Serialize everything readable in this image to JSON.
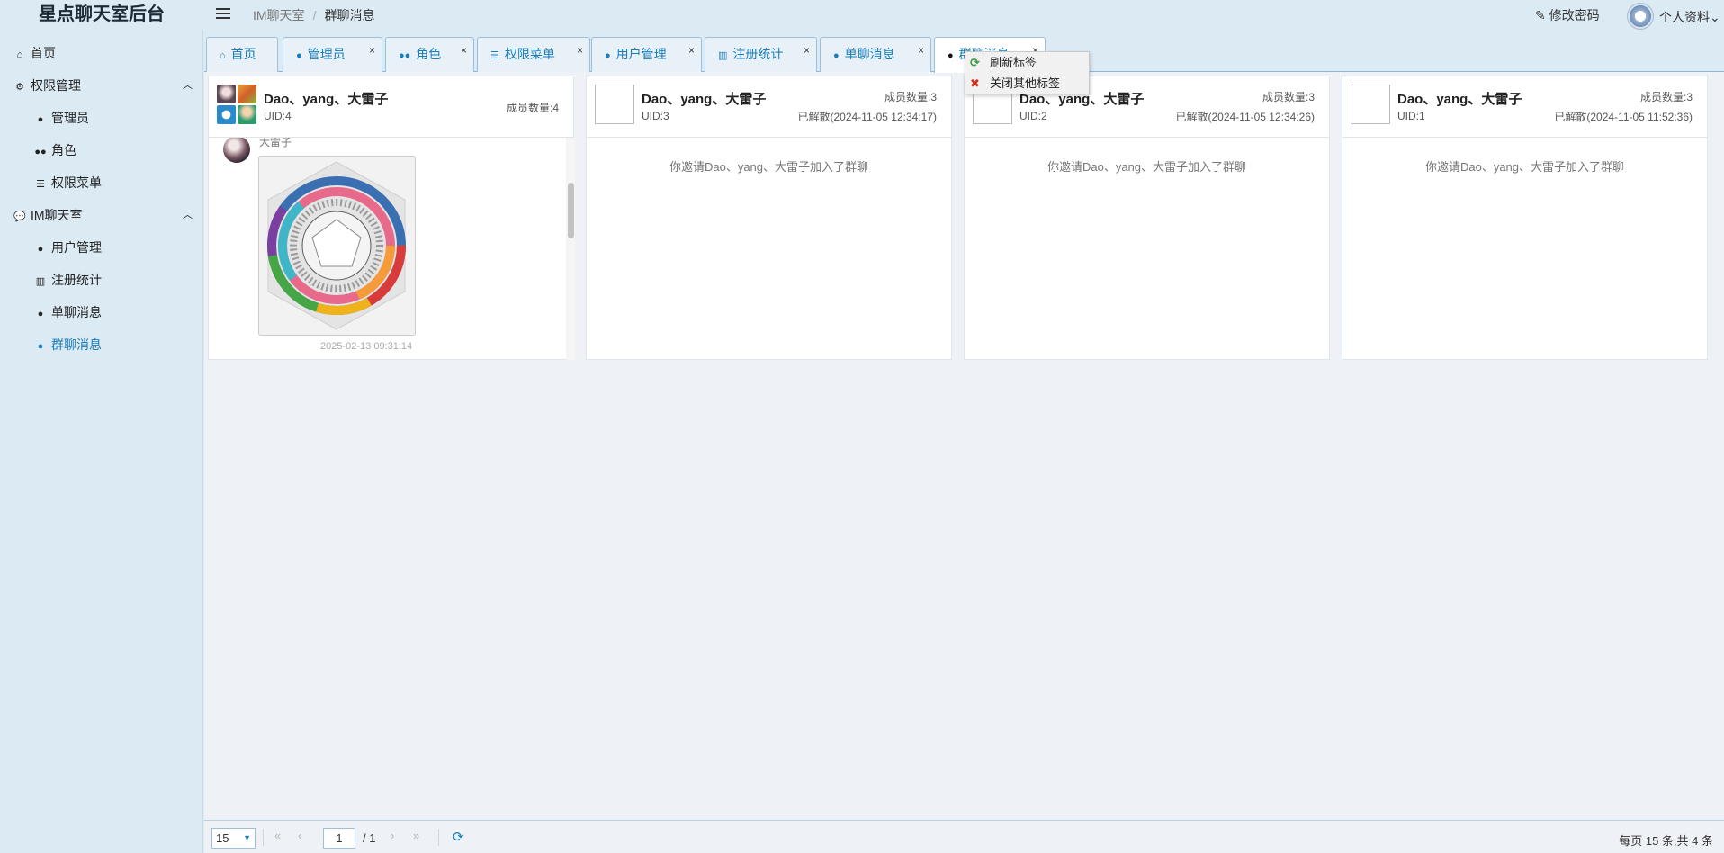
{
  "app": {
    "title": "星点聊天室后台"
  },
  "breadcrumb": {
    "parent": "IM聊天室",
    "current": "群聊消息"
  },
  "header": {
    "change_password": "修改密码",
    "profile": "个人资料"
  },
  "sidebar": {
    "home": "首页",
    "perm_group": "权限管理",
    "admins": "管理员",
    "roles": "角色",
    "perm_menu": "权限菜单",
    "im_group": "IM聊天室",
    "users": "用户管理",
    "reg_stats": "注册统计",
    "single_msgs": "单聊消息",
    "group_msgs": "群聊消息"
  },
  "tabs": [
    {
      "label": "首页",
      "icon": "home-icon"
    },
    {
      "label": "管理员",
      "icon": "user-icon"
    },
    {
      "label": "角色",
      "icon": "users-icon"
    },
    {
      "label": "权限菜单",
      "icon": "list-icon"
    },
    {
      "label": "用户管理",
      "icon": "user-icon"
    },
    {
      "label": "注册统计",
      "icon": "bar-chart-icon"
    },
    {
      "label": "单聊消息",
      "icon": "comment-icon"
    },
    {
      "label": "群聊消息",
      "icon": "comments-icon"
    }
  ],
  "context_menu": {
    "refresh": "刷新标签",
    "close_others": "关闭其他标签"
  },
  "groups": [
    {
      "name": "Dao、yang、大雷子",
      "uid": "UID:4",
      "count": "成员数量:4",
      "message": {
        "sender": "大雷子",
        "time": "2025-02-13 09:31:14"
      }
    },
    {
      "name": "Dao、yang、大雷子",
      "uid": "UID:3",
      "count": "成员数量:3",
      "status": "已解散(2024-11-05 12:34:17)",
      "system_msg": "你邀请Dao、yang、大雷子加入了群聊"
    },
    {
      "name": "Dao、yang、大雷子",
      "uid": "UID:2",
      "count": "成员数量:3",
      "status": "已解散(2024-11-05 12:34:26)",
      "system_msg": "你邀请Dao、yang、大雷子加入了群聊"
    },
    {
      "name": "Dao、yang、大雷子",
      "uid": "UID:1",
      "count": "成员数量:3",
      "status": "已解散(2024-11-05 11:52:36)",
      "system_msg": "你邀请Dao、yang、大雷子加入了群聊"
    }
  ],
  "pager": {
    "page_size": "15",
    "page": "1",
    "total_pages": "/ 1",
    "info": "每页 15 条,共 4 条"
  },
  "colors": {
    "accent": "#1a7db8",
    "sidebar_bg": "#dceaf4",
    "content_bg": "#eef2f6"
  }
}
